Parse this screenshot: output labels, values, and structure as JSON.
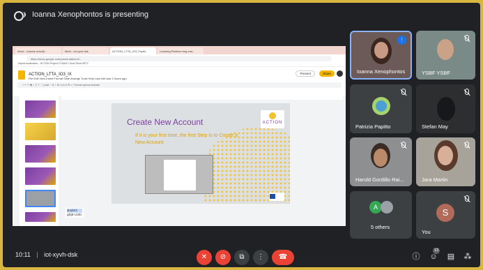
{
  "meeting": {
    "presenting_text": "Ioanna Xenophontos is presenting",
    "time": "10:11",
    "separator": "|",
    "code": "iot-xyvh-dsk",
    "participants_count": "13"
  },
  "browser": {
    "tabs": [
      "Inbox - ioanna.xeno@...",
      "Meet - iot-xyvh-dsk",
      "ACTION_LTTA_IO3_Pupils",
      "Learning Platform beg.end..."
    ],
    "address": "https://docs.google.com/presentation/d/...",
    "bookmarks": "Import bookmarks...   ACTION Project   CYMAIC   Cloud Store   ARTY"
  },
  "slides_app": {
    "doc_title": "ACTION_LTTA_IO3_IX",
    "menu": "File  Edit  View  Insert  Format  Slide  Arrange  Tools  Help   Last edit was 2 hours ago",
    "present_label": "Present",
    "share_label": "Share",
    "toolbar_text": "+  ↶  ↷  🖶  ⌕  ▢  T  ◌  ╲   Arial   −  11  +   B  I  U  A   ⛓  ☰  ≡  ⁝   Format options   Animate"
  },
  "slide": {
    "title": "Create New Account",
    "bullet": "If it is your first time, the first Step is to Create a New Account",
    "logo_text": "ACTION"
  },
  "notes": {
    "line1": "student",
    "line2": "gEjB-U30c"
  },
  "participants": [
    {
      "name": "Ioanna Xenophontos",
      "speaking": true
    },
    {
      "name": "YSBF YSBF",
      "muted": true
    },
    {
      "name": "Patrizia Papitto",
      "muted": true
    },
    {
      "name": "Stefan May",
      "muted": true
    },
    {
      "name": "Harold Gordillo Rai...",
      "muted": true
    },
    {
      "name": "Jara Martin",
      "muted": true
    },
    {
      "name": "5 others",
      "avatar_letter": "A"
    },
    {
      "name": "You",
      "avatar_letter": "S",
      "muted": true
    }
  ],
  "colors": {
    "frame": "#d9b640",
    "meet_bg": "#202124",
    "tile_bg": "#3c4043",
    "hangup": "#ea4335",
    "slide_title": "#7b3fa0",
    "slide_text": "#d4a017"
  },
  "icons": {
    "mic": "mic-off-icon",
    "camera": "camera-off-icon",
    "present": "present-screen-icon",
    "more": "more-options-icon",
    "hangup": "hangup-icon",
    "info": "info-icon",
    "people": "people-icon",
    "chat": "chat-icon",
    "activities": "activities-icon"
  }
}
